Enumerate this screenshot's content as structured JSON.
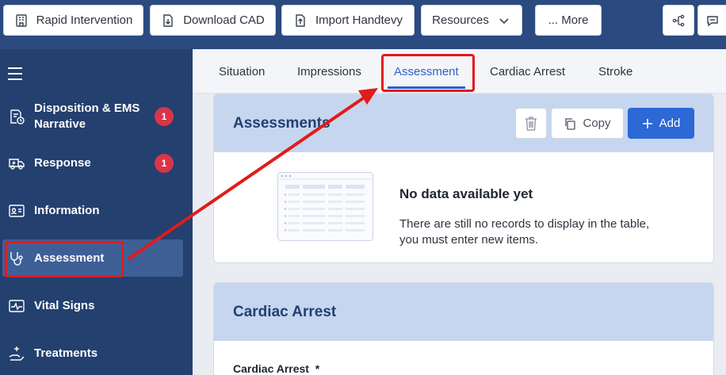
{
  "toolbar": {
    "rapid_intervention": "Rapid Intervention",
    "download_cad": "Download CAD",
    "import_handtevy": "Import Handtevy",
    "resources": "Resources",
    "more": "... More"
  },
  "sidebar": {
    "items": [
      {
        "label_line1": "Disposition & EMS",
        "label_line2": "Narrative",
        "badge": "1"
      },
      {
        "label": "Response",
        "badge": "1"
      },
      {
        "label": "Information"
      },
      {
        "label": "Assessment"
      },
      {
        "label": "Vital Signs"
      },
      {
        "label": "Treatments"
      }
    ]
  },
  "tabs": [
    "Situation",
    "Impressions",
    "Assessment",
    "Cardiac Arrest",
    "Stroke"
  ],
  "assessments_card": {
    "title": "Assessments",
    "copy_label": "Copy",
    "add_label": "Add",
    "empty_title": "No data available yet",
    "empty_text": "There are still no records to display in the table, you must enter new items."
  },
  "cardiac_card": {
    "title": "Cardiac Arrest",
    "field_label": "Cardiac Arrest  *"
  },
  "colors": {
    "sidebar_bg": "#23406f",
    "accent": "#2c62c9",
    "annotation": "#e11b1b"
  }
}
